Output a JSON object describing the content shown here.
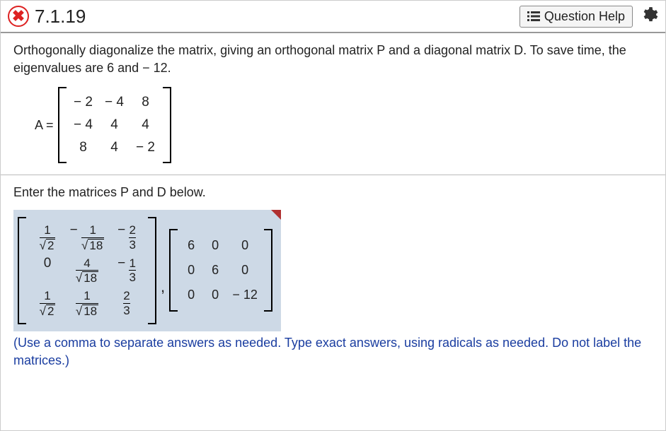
{
  "header": {
    "question_number": "7.1.19",
    "help_label": "Question Help"
  },
  "prompt": "Orthogonally diagonalize the matrix, giving an orthogonal matrix P and a diagonal matrix D. To save time, the eigenvalues are 6 and − 12.",
  "A_label": "A =",
  "A": [
    [
      "− 2",
      "− 4",
      "8"
    ],
    [
      "− 4",
      "4",
      "4"
    ],
    [
      "8",
      "4",
      "− 2"
    ]
  ],
  "enter_instruction": "Enter the matrices P and D below.",
  "P": {
    "r0c0": {
      "sign": "",
      "num": "1",
      "den_rad": "2"
    },
    "r0c1": {
      "sign": "− ",
      "num": "1",
      "den_rad": "18"
    },
    "r0c2": {
      "sign": "− ",
      "num": "2",
      "den": "3"
    },
    "r1c0": {
      "plain": "0"
    },
    "r1c1": {
      "sign": "",
      "num": "4",
      "den_rad": "18"
    },
    "r1c2": {
      "sign": "− ",
      "num": "1",
      "den": "3"
    },
    "r2c0": {
      "sign": "",
      "num": "1",
      "den_rad": "2"
    },
    "r2c1": {
      "sign": "",
      "num": "1",
      "den_rad": "18"
    },
    "r2c2": {
      "sign": "",
      "num": "2",
      "den": "3"
    }
  },
  "comma": ",",
  "D": [
    [
      "6",
      "0",
      "0"
    ],
    [
      "0",
      "6",
      "0"
    ],
    [
      "0",
      "0",
      "− 12"
    ]
  ],
  "note": "(Use a comma to separate answers as needed. Type exact answers, using radicals as needed. Do not label the matrices.)",
  "chart_data": {
    "type": "table",
    "title": "Orthogonal diagonalization of A",
    "matrix_A": [
      [
        -2,
        -4,
        8
      ],
      [
        -4,
        4,
        4
      ],
      [
        8,
        4,
        -2
      ]
    ],
    "eigenvalues": [
      6,
      6,
      -12
    ],
    "matrix_D": [
      [
        6,
        0,
        0
      ],
      [
        0,
        6,
        0
      ],
      [
        0,
        0,
        -12
      ]
    ],
    "matrix_P_exact": [
      [
        "1/sqrt(2)",
        "-1/sqrt(18)",
        "-2/3"
      ],
      [
        "0",
        "4/sqrt(18)",
        "-1/3"
      ],
      [
        "1/sqrt(2)",
        "1/sqrt(18)",
        "2/3"
      ]
    ]
  }
}
